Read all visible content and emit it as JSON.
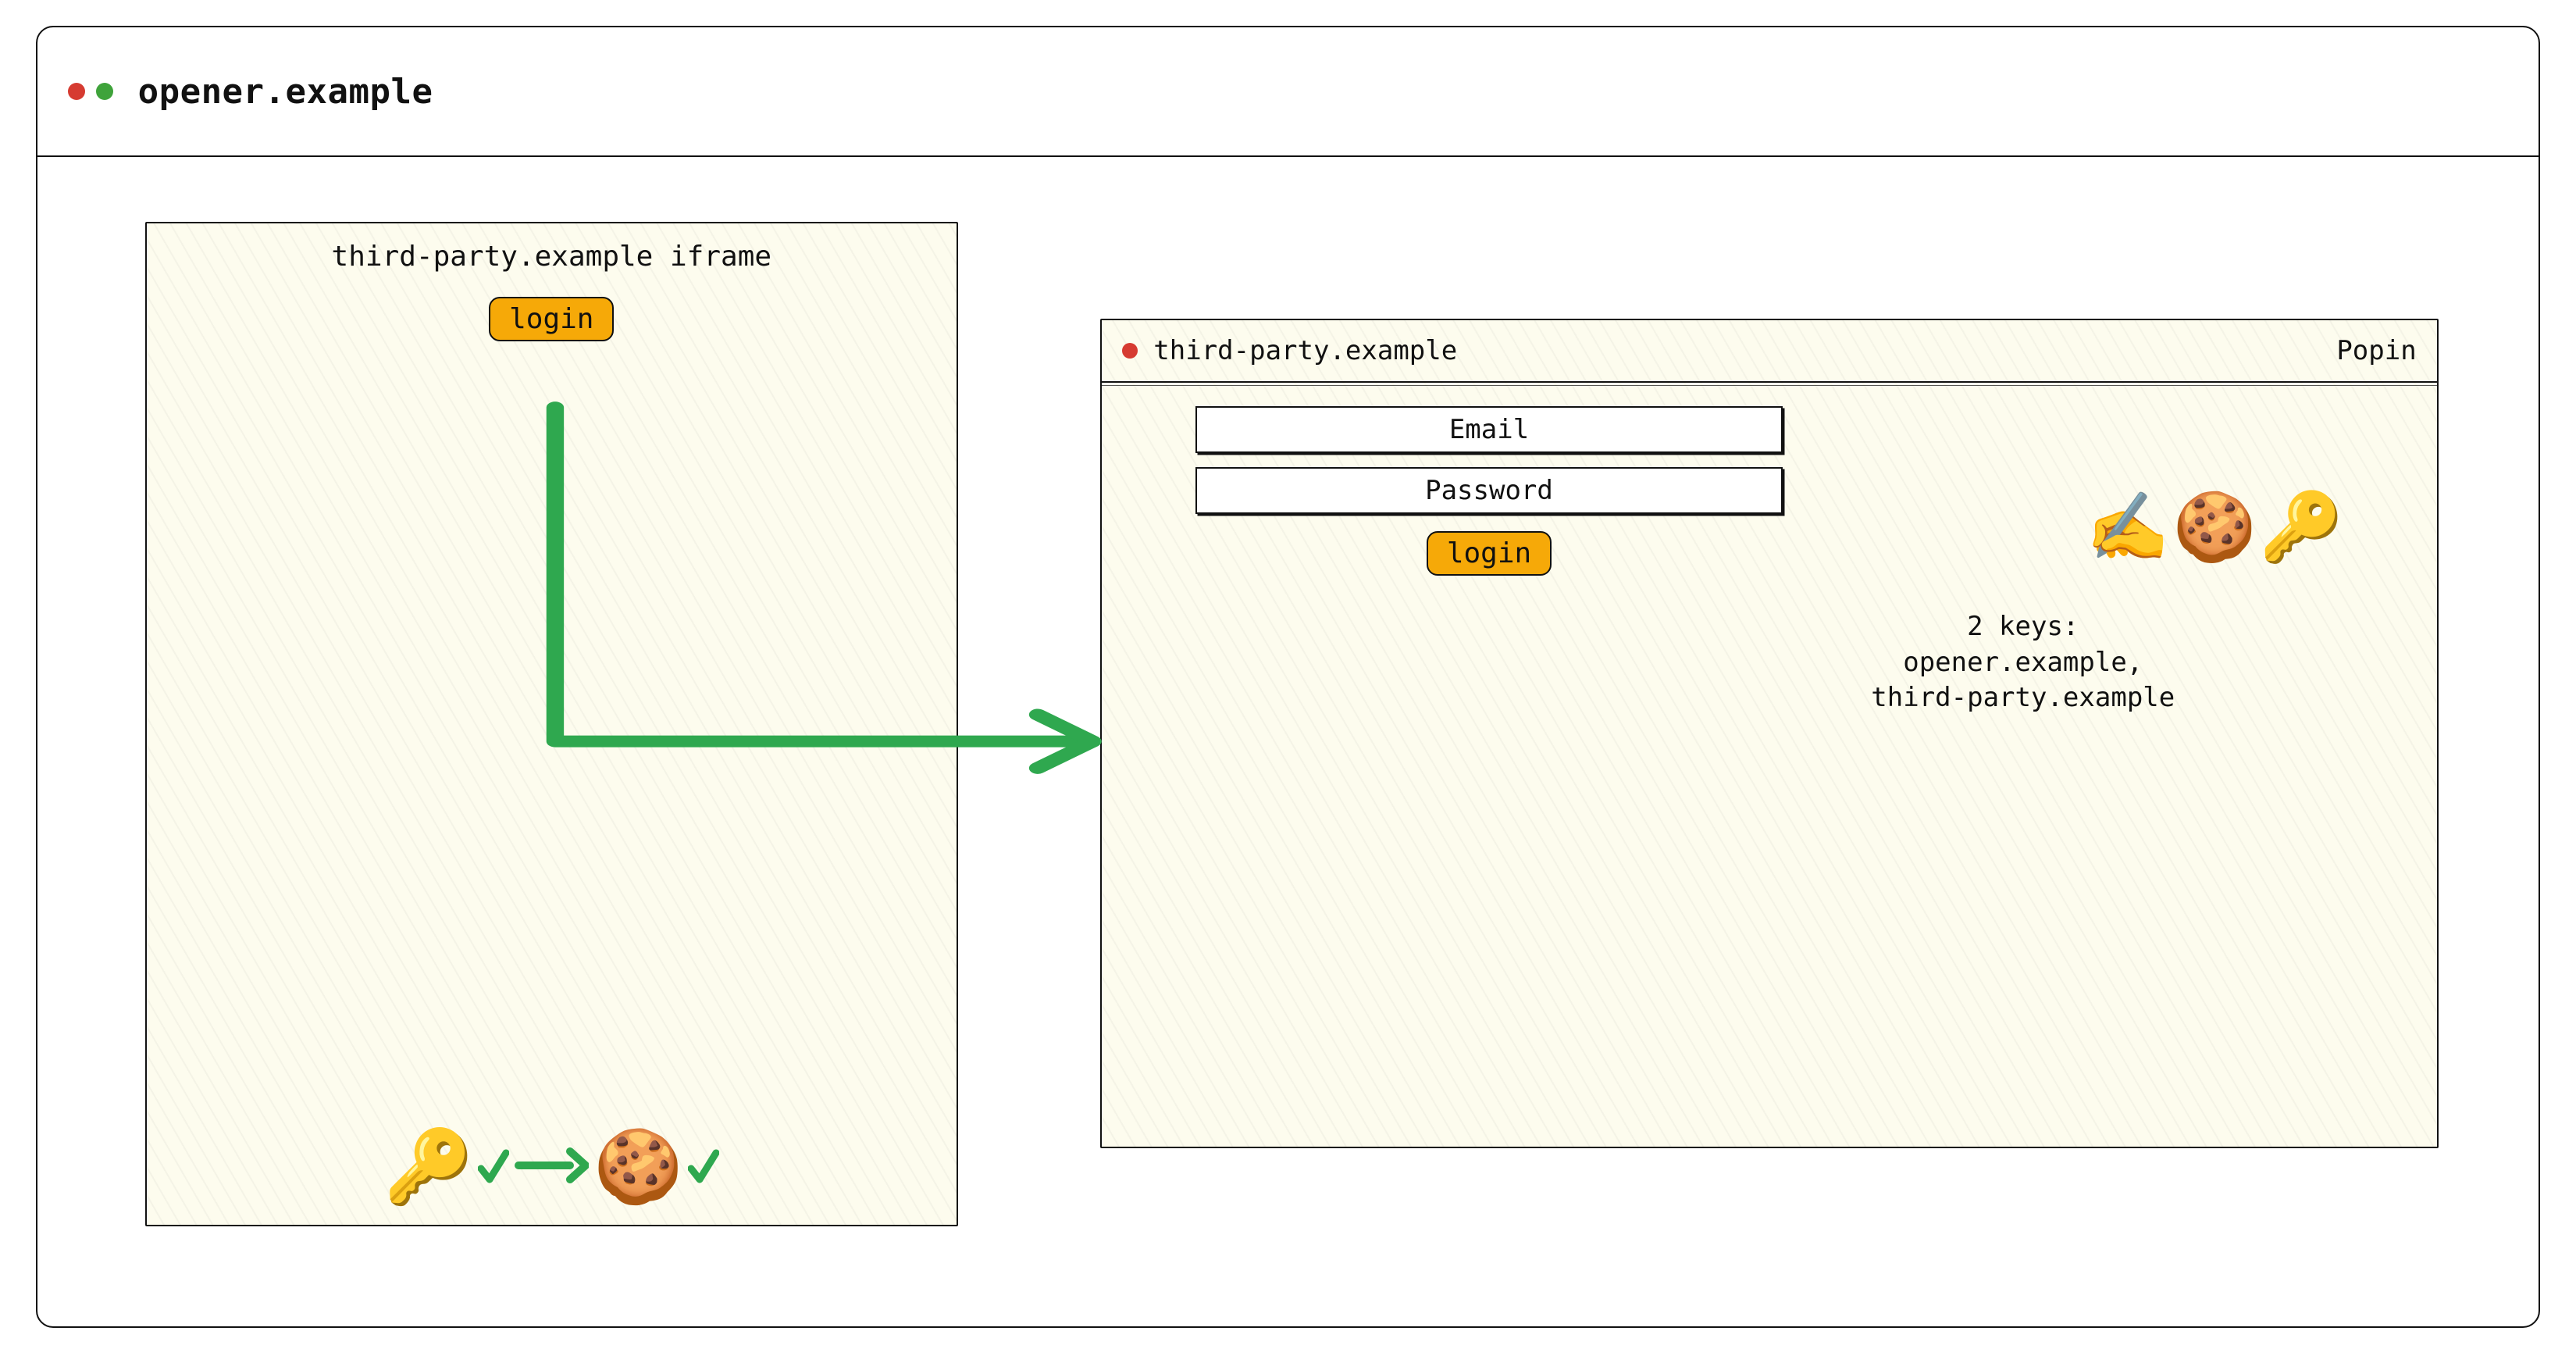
{
  "window": {
    "title": "opener.example"
  },
  "iframe": {
    "title": "third-party.example iframe",
    "login_label": "login"
  },
  "popin": {
    "title": "third-party.example",
    "tag": "Popin",
    "email_label": "Email",
    "password_label": "Password",
    "login_label": "login",
    "keys_heading": "2 keys:",
    "keys_line1": "opener.example,",
    "keys_line2": "third-party.example"
  },
  "colors": {
    "panel_bg": "#fdfcee",
    "accent": "#f6a908",
    "arrow": "#2fa84f",
    "ink": "#111111"
  },
  "icons": {
    "key": "🔑",
    "cookie": "🍪",
    "writing_hand": "✍️"
  }
}
